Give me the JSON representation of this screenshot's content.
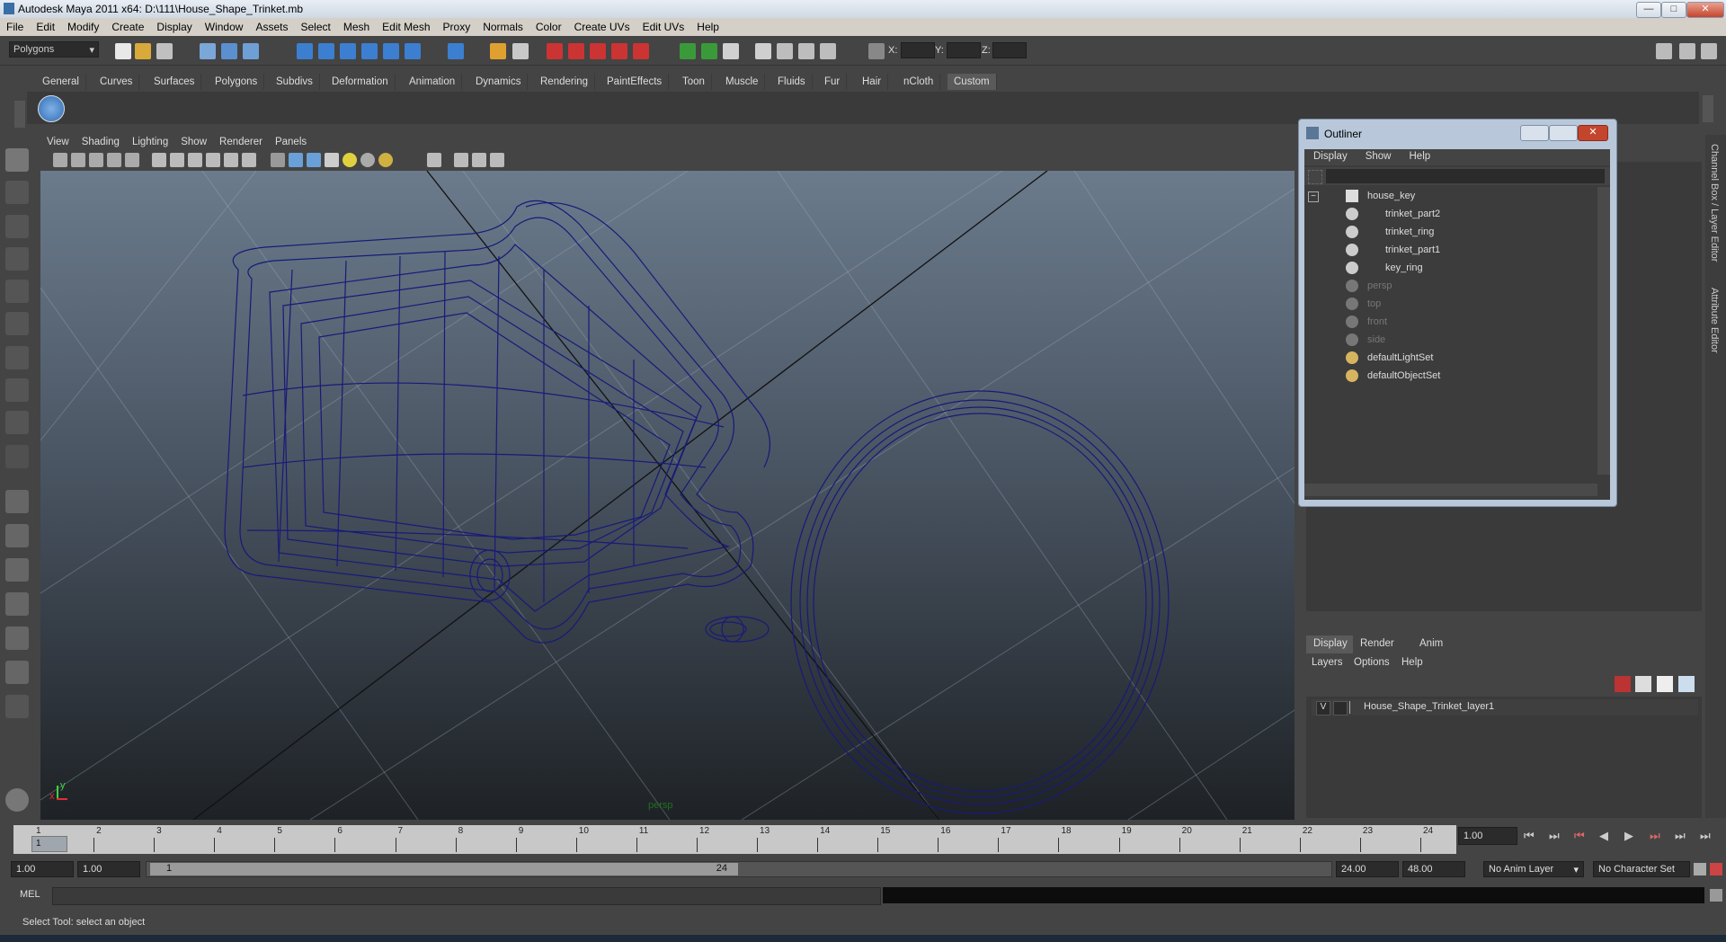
{
  "window": {
    "title": "Autodesk Maya 2011 x64: D:\\111\\House_Shape_Trinket.mb",
    "min": "—",
    "max": "□",
    "close": "✕"
  },
  "menubar": [
    "File",
    "Edit",
    "Modify",
    "Create",
    "Display",
    "Window",
    "Assets",
    "Select",
    "Mesh",
    "Edit Mesh",
    "Proxy",
    "Normals",
    "Color",
    "Create UVs",
    "Edit UVs",
    "Help"
  ],
  "statusline": {
    "mode": "Polygons",
    "x_label": "X:",
    "y_label": "Y:",
    "z_label": "Z:"
  },
  "shelf_tabs": [
    "General",
    "Curves",
    "Surfaces",
    "Polygons",
    "Subdivs",
    "Deformation",
    "Animation",
    "Dynamics",
    "Rendering",
    "PaintEffects",
    "Toon",
    "Muscle",
    "Fluids",
    "Fur",
    "Hair",
    "nCloth",
    "Custom"
  ],
  "shelf_active": "Custom",
  "panel_menu": [
    "View",
    "Shading",
    "Lighting",
    "Show",
    "Renderer",
    "Panels"
  ],
  "viewport": {
    "camera_label": "persp",
    "axis_x": "x",
    "axis_y": "y"
  },
  "outliner": {
    "title": "Outliner",
    "menu": [
      "Display",
      "Show",
      "Help"
    ],
    "items": [
      {
        "label": "house_key",
        "level": 0,
        "dim": false
      },
      {
        "label": "trinket_part2",
        "level": 1,
        "dim": false
      },
      {
        "label": "trinket_ring",
        "level": 1,
        "dim": false
      },
      {
        "label": "trinket_part1",
        "level": 1,
        "dim": false
      },
      {
        "label": "key_ring",
        "level": 1,
        "dim": false
      },
      {
        "label": "persp",
        "level": 0,
        "dim": true
      },
      {
        "label": "top",
        "level": 0,
        "dim": true
      },
      {
        "label": "front",
        "level": 0,
        "dim": true
      },
      {
        "label": "side",
        "level": 0,
        "dim": true
      },
      {
        "label": "defaultLightSet",
        "level": 0,
        "dim": false
      },
      {
        "label": "defaultObjectSet",
        "level": 0,
        "dim": false
      }
    ]
  },
  "side_tabs": [
    "Channel Box / Layer Editor",
    "Attribute Editor"
  ],
  "layer_editor": {
    "tabs": [
      "Display",
      "Render",
      "Anim"
    ],
    "menu": [
      "Layers",
      "Options",
      "Help"
    ],
    "layer_visible": "V",
    "layer_name": "House_Shape_Trinket_layer1"
  },
  "timeline": {
    "ticks": [
      "1",
      "2",
      "3",
      "4",
      "5",
      "6",
      "7",
      "8",
      "9",
      "10",
      "11",
      "12",
      "13",
      "14",
      "15",
      "16",
      "17",
      "18",
      "19",
      "20",
      "21",
      "22",
      "23",
      "24"
    ],
    "current_frame_marker": "1",
    "current_time": "1.00"
  },
  "range": {
    "start": "1.00",
    "playback_start": "1.00",
    "slider_left": "1",
    "slider_right": "24",
    "playback_end": "24.00",
    "end": "48.00",
    "anim_layer": "No Anim Layer",
    "char_set": "No Character Set"
  },
  "cmdline": {
    "label": "MEL"
  },
  "helpline": {
    "text": "Select Tool: select an object"
  }
}
